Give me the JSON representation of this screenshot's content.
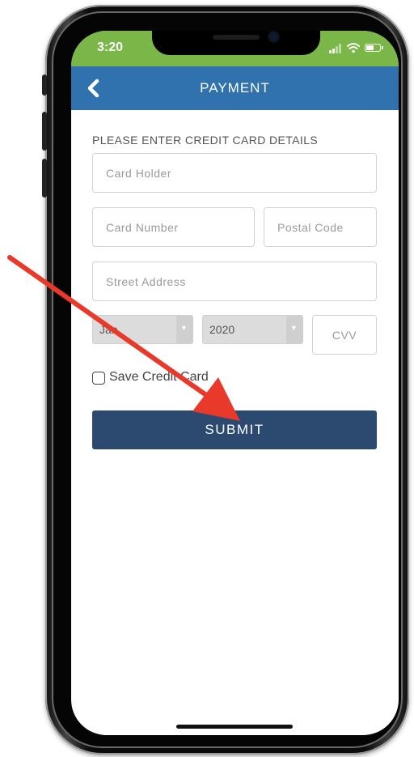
{
  "status_bar": {
    "time": "3:20"
  },
  "header": {
    "title": "PAYMENT"
  },
  "form": {
    "section_label": "PLEASE ENTER CREDIT CARD DETAILS",
    "card_holder": {
      "placeholder": "Card Holder",
      "value": ""
    },
    "card_number": {
      "placeholder": "Card Number",
      "value": ""
    },
    "postal_code": {
      "placeholder": "Postal Code",
      "value": ""
    },
    "street_address": {
      "placeholder": "Street Address",
      "value": ""
    },
    "expiry_month": {
      "selected": "Jan"
    },
    "expiry_year": {
      "selected": "2020"
    },
    "cvv": {
      "placeholder": "CVV",
      "value": ""
    },
    "save_card": {
      "label": "Save Credit Card",
      "checked": false
    },
    "submit_label": "SUBMIT"
  },
  "colors": {
    "status_bar": "#7ab648",
    "header": "#2f72ad",
    "submit_button": "#2c4a70",
    "annotation_arrow": "#e8392a"
  },
  "icons": {
    "back": "chevron-left-icon",
    "signal": "cellular-signal-icon",
    "wifi": "wifi-icon",
    "battery": "battery-icon"
  }
}
